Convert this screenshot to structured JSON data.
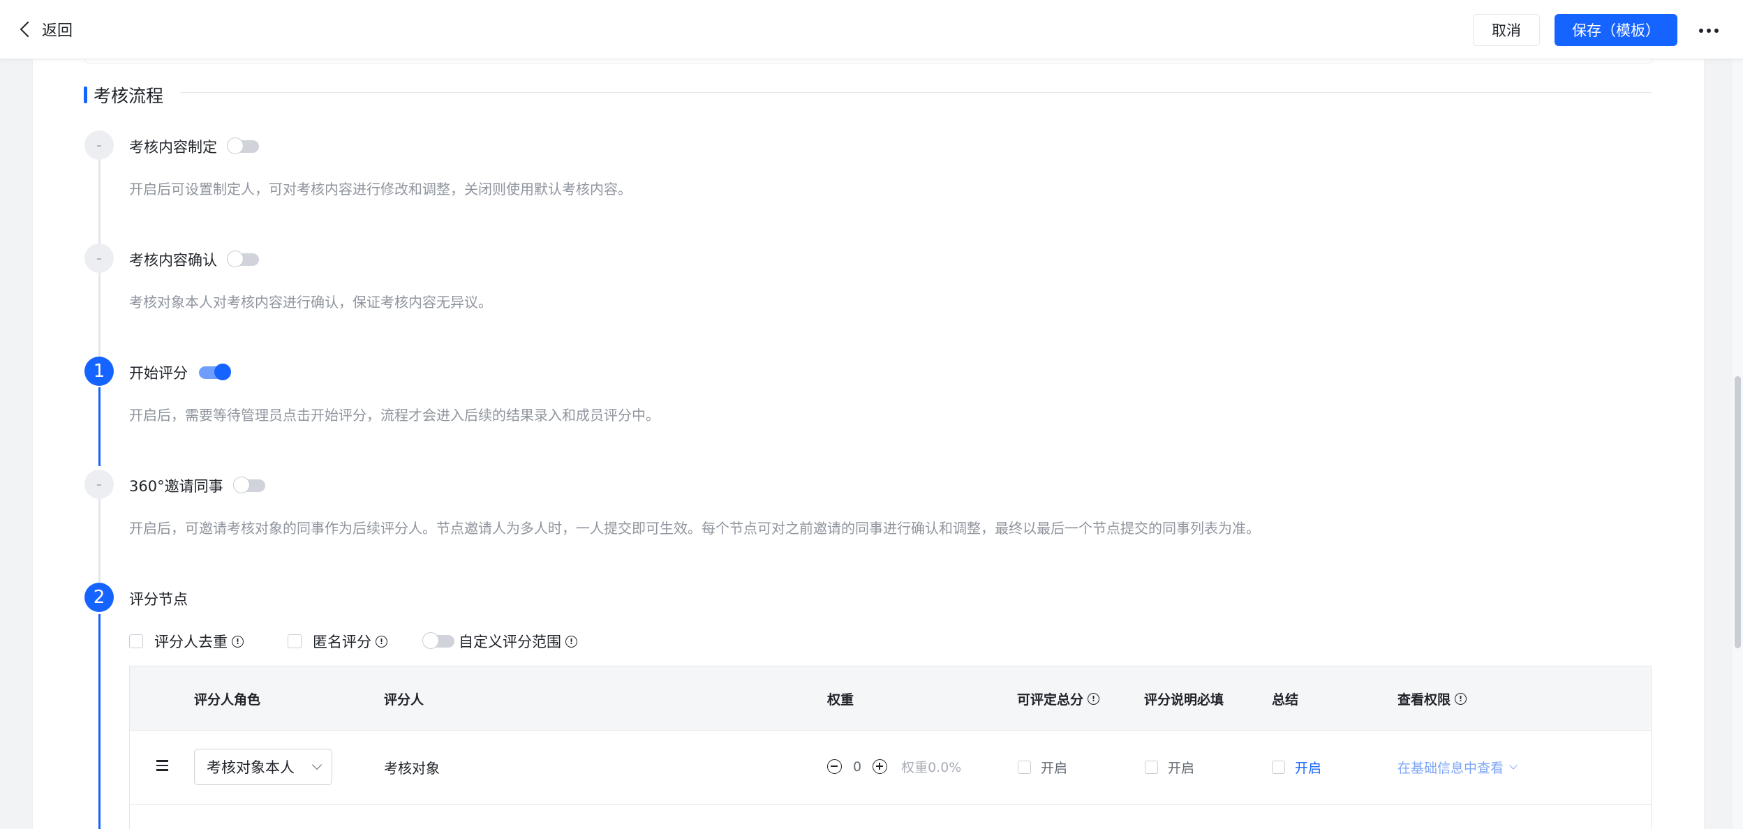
{
  "header": {
    "back_label": "返回",
    "cancel_label": "取消",
    "save_label": "保存（模板）"
  },
  "section": {
    "title": "考核流程"
  },
  "steps": [
    {
      "marker": "-",
      "title": "考核内容制定",
      "enabled": false,
      "desc": "开启后可设置制定人，可对考核内容进行修改和调整，关闭则使用默认考核内容。"
    },
    {
      "marker": "-",
      "title": "考核内容确认",
      "enabled": false,
      "desc": "考核对象本人对考核内容进行确认，保证考核内容无异议。"
    },
    {
      "marker": "1",
      "title": "开始评分",
      "enabled": true,
      "desc": "开启后，需要等待管理员点击开始评分，流程才会进入后续的结果录入和成员评分中。"
    },
    {
      "marker": "-",
      "title": "360°邀请同事",
      "enabled": false,
      "desc": "开启后，可邀请考核对象的同事作为后续评分人。节点邀请人为多人时，一人提交即可生效。每个节点可对之前邀请的同事进行确认和调整，最终以最后一个节点提交的同事列表为准。"
    },
    {
      "marker": "2",
      "title": "评分节点"
    }
  ],
  "options": {
    "dedupe_label": "评分人去重",
    "anonymous_label": "匿名评分",
    "custom_scope_label": "自定义评分范围"
  },
  "table": {
    "headers": {
      "role": "评分人角色",
      "rater": "评分人",
      "weight": "权重",
      "total": "可评定总分",
      "comment_required": "评分说明必填",
      "summary": "总结",
      "permission": "查看权限"
    },
    "rows": [
      {
        "role": "考核对象本人",
        "rater": "考核对象",
        "weight_value": "0",
        "weight_pct": "权重0.0%",
        "total_label": "开启",
        "comment_label": "开启",
        "summary_label": "开启",
        "permission": "在基础信息中查看"
      }
    ]
  },
  "colors": {
    "primary": "#1664ff",
    "muted_text": "#8f959e"
  }
}
